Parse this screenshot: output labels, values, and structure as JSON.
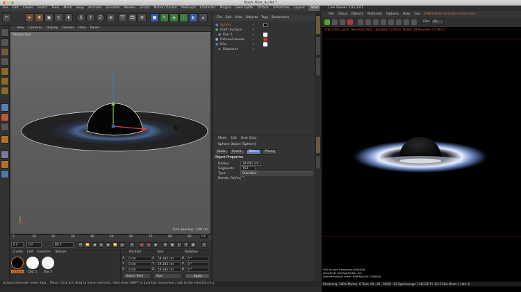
{
  "window": {
    "title": "Black Hole_A.c4d *"
  },
  "menubar": {
    "items": [
      "File",
      "Edit",
      "Create",
      "Select",
      "Tools",
      "Mesh",
      "Snap",
      "Animate",
      "Simulate",
      "Render",
      "Sculpt",
      "Motion Tracker",
      "MoGraph",
      "Character",
      "Plugins",
      "Dem Epilth",
      "Octane",
      "X-Particles",
      "Layout"
    ],
    "layout_value": "Startup"
  },
  "viewport": {
    "menu": [
      "View",
      "Cameras",
      "Display",
      "Options",
      "Filter",
      "Panel"
    ],
    "label": "Perspective",
    "grid_spacing": "Grid Spacing : 100 cm"
  },
  "timeline": {
    "ticks": [
      "0",
      "10",
      "20",
      "30",
      "40",
      "50",
      "60",
      "70",
      "80",
      "90"
    ],
    "end_frame": "0 F"
  },
  "transport": {
    "start": "0 F",
    "current": "0 F",
    "end": "80 F",
    "end2": "90 F"
  },
  "materials": {
    "menu": [
      "Create",
      "Edit",
      "Function",
      "Texture"
    ],
    "items": [
      {
        "label": "Octane"
      },
      {
        "label": "Disc 1"
      },
      {
        "label": "Disc 2"
      }
    ],
    "colors": [
      "#000000",
      "#ffffff",
      "#f4f4f4"
    ]
  },
  "coordinates": {
    "headers": {
      "position": "Position",
      "size": "Size",
      "rotation": "Rotation"
    },
    "rows": [
      {
        "axis": "X",
        "pos": "0 cm",
        "size": "59.383 cm",
        "rot_axis": "H",
        "rot": "0 °"
      },
      {
        "axis": "Y",
        "pos": "0 cm",
        "size": "59.383 cm",
        "rot_axis": "P",
        "rot": "0 °"
      },
      {
        "axis": "Z",
        "pos": "0 cm",
        "size": "59.383 cm",
        "rot_axis": "B",
        "rot": "0 °"
      }
    ],
    "mode": "Object (Rel)",
    "size_mode": "Size",
    "apply": "Apply"
  },
  "status": "Octane:Generate mesh data...   Move: Click and drag to move elements. Hold down SHIFT to quantize movement / add to the selection in p",
  "object_manager": {
    "menu": [
      "File",
      "Edit",
      "View",
      "Objects",
      "Tags",
      "Bookmarks"
    ],
    "objects": [
      {
        "name": "Sphere",
        "color": "#e06a3a",
        "selected": true
      },
      {
        "name": "Cloth Surface",
        "color": "#cfcfcf",
        "selected": false
      },
      {
        "name": "Disc 1",
        "color": "#cfcfcf",
        "selected": false
      },
      {
        "name": "OctaneCamera",
        "color": "#cfcfcf",
        "selected": false
      },
      {
        "name": "Disc",
        "color": "#cfcfcf",
        "selected": false
      },
      {
        "name": "Displacer",
        "color": "#cfcfcf",
        "selected": false
      }
    ]
  },
  "attributes": {
    "menu": [
      "Mode",
      "Edit",
      "User Data"
    ],
    "object_title": "Sphere Object [Sphere]",
    "tabs": [
      "Basic",
      "Coord.",
      "Object",
      "Phong"
    ],
    "active_tab": "Object",
    "section": "Object Properties",
    "fields": [
      {
        "label": "Radius",
        "value": "29.691 cm"
      },
      {
        "label": "Segments",
        "value": "150"
      },
      {
        "label": "Type",
        "value": "Standard"
      },
      {
        "label": "Render Perfect",
        "value": "✓"
      }
    ]
  },
  "live_viewer": {
    "title": "Live Viewer 3.03.3-R1",
    "menu": [
      "File",
      "Cloud",
      "Objects",
      "Materials",
      "Options",
      "Help",
      "Gui"
    ],
    "project": "[FINISHED] Generate mesh data...",
    "channel_label": "Chn:",
    "channel_value": "DL",
    "stats": "Check:0ms./2ms. MeshGen:0ms. Update[G]:237ms. Nodes:19 Movable:3  0 Mot:3",
    "info": [
      "Out-of-core used/max:0Kb/4Gb",
      "Grey8/16: 0/0        Rgb32/64: 4/4",
      "Used/free/total vram: 858Mb/4.617Gb/6Gb"
    ],
    "render_status": "Rendering: 100%   Ms/sec: 0   Time: 00 : 00 : 00/00 : 02   Spp/maxspp: 128/128   Tri: 0/2.118m   Mesh: 1   Hair: 0"
  }
}
